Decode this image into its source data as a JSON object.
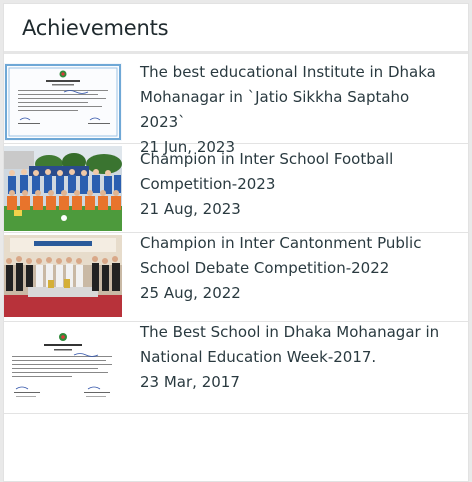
{
  "header": {
    "title": "Achievements"
  },
  "items": [
    {
      "title": "The best educational Institute in Dhaka Mohanagar in `Jatio Sikkha Saptaho 2023`",
      "date": "21 Jun, 2023",
      "image": "certificate-image"
    },
    {
      "title": "Champion in Inter School Football Competition-2023",
      "date": "21 Aug, 2023",
      "image": "football-team-photo"
    },
    {
      "title": "Champion in Inter Cantonment Public School Debate Competition-2022",
      "date": "25 Aug, 2022",
      "image": "debate-team-photo"
    },
    {
      "title": "The Best School in Dhaka Mohanagar in National Education Week-2017.",
      "date": "23 Mar, 2017",
      "image": "certificate-image"
    }
  ],
  "colors": {
    "text": "#2a3a40",
    "heading": "#1f2a2e",
    "divider": "#e3e3e3",
    "certificate_border": "#6fa8d6",
    "field": "#3f9a3a",
    "jerseys": "#e8742c"
  }
}
